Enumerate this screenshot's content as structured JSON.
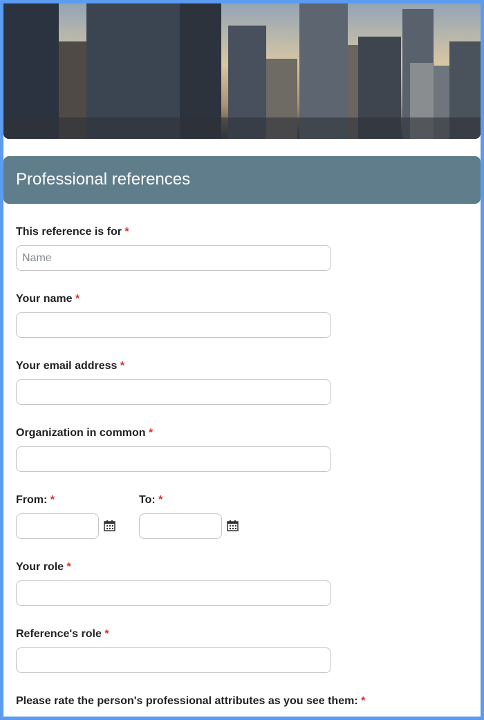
{
  "header": {
    "title": "Professional references"
  },
  "banner": {
    "image": "city-skyline-photo"
  },
  "required_mark": "*",
  "questions": {
    "reference_for": {
      "label": "This reference is for",
      "placeholder": "Name",
      "value": ""
    },
    "your_name": {
      "label": "Your name",
      "value": ""
    },
    "email": {
      "label": "Your email address",
      "value": ""
    },
    "organization": {
      "label": "Organization in common",
      "value": ""
    },
    "from": {
      "label": "From:",
      "value": "",
      "icon": "calendar-icon"
    },
    "to": {
      "label": "To:",
      "value": "",
      "icon": "calendar-icon"
    },
    "your_role": {
      "label": "Your role",
      "value": ""
    },
    "reference_role": {
      "label": "Reference's role",
      "value": ""
    },
    "rating": {
      "label": "Please rate the person's professional attributes as you see them:"
    }
  },
  "colors": {
    "header_bg": "#607d8b",
    "page_bg": "#5b9bf0",
    "required": "#d93025"
  }
}
